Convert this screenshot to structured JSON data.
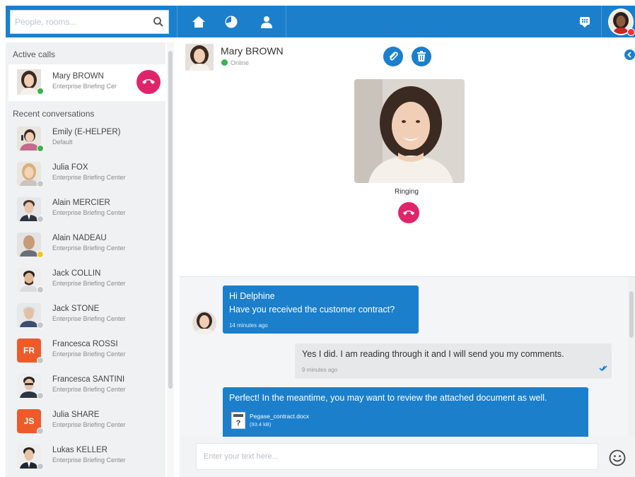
{
  "search": {
    "placeholder": "People, rooms..."
  },
  "left": {
    "active_calls_title": "Active calls",
    "recent_title": "Recent conversations",
    "active_call": {
      "name": "Mary BROWN",
      "sub": "Enterprise Briefing Cer"
    },
    "contacts": [
      {
        "name": "Emily (E-HELPER)",
        "sub": "Default"
      },
      {
        "name": "Julia FOX",
        "sub": "Enterprise Briefing Center"
      },
      {
        "name": "Alain MERCIER",
        "sub": "Enterprise Briefing Center"
      },
      {
        "name": "Alain NADEAU",
        "sub": "Enterprise Briefing Center"
      },
      {
        "name": "Jack COLLIN",
        "sub": "Enterprise Briefing Center"
      },
      {
        "name": "Jack STONE",
        "sub": "Enterprise Briefing Center"
      },
      {
        "name": "Francesca ROSSI",
        "sub": "Enterprise Briefing Center",
        "initials": "FR"
      },
      {
        "name": "Francesca SANTINI",
        "sub": "Enterprise Briefing Center"
      },
      {
        "name": "Julia SHARE",
        "sub": "Enterprise Briefing Center",
        "initials": "JS"
      },
      {
        "name": "Lukas KELLER",
        "sub": "Enterprise Briefing Center"
      }
    ]
  },
  "conversation": {
    "name": "Mary BROWN",
    "status": "Online",
    "call_status": "Ringing"
  },
  "messages": [
    {
      "line1": "Hi Delphine",
      "line2": "Have you received the customer contract?",
      "time": "14 minutes ago"
    },
    {
      "text": "Yes I did. I am reading through it and I will send you my comments.",
      "time": "9 minutes ago"
    },
    {
      "text": "Perfect! In the meantime, you may want to review the attached document as well.",
      "attachment_name": "Pegase_contract.docx",
      "attachment_size": "(93.4 kB)"
    }
  ],
  "composer": {
    "placeholder": "Enter your text here..."
  },
  "colors": {
    "primary": "#1b7fcc",
    "hangup": "#e0246b",
    "online": "#3cb34a",
    "initials_bg": "#ef5a2a"
  },
  "icons": [
    "search-icon",
    "home-icon",
    "dashboard-icon",
    "contacts-icon",
    "apps-icon",
    "paperclip-icon",
    "trash-icon",
    "hangup-icon",
    "collapse-icon",
    "emoji-icon",
    "file-icon",
    "read-receipt-icon"
  ]
}
